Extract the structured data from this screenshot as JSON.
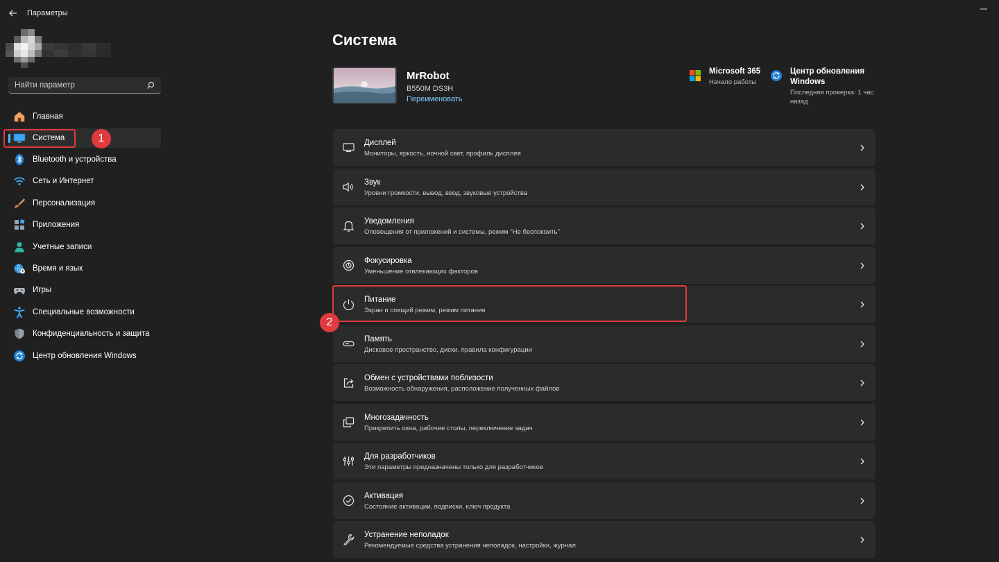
{
  "window": {
    "title": "Параметры"
  },
  "search": {
    "placeholder": "Найти параметр"
  },
  "sidebar": {
    "items": [
      {
        "label": "Главная",
        "icon": "home-icon"
      },
      {
        "label": "Система",
        "icon": "system-icon",
        "selected": true
      },
      {
        "label": "Bluetooth и устройства",
        "icon": "bluetooth-icon"
      },
      {
        "label": "Сеть и Интернет",
        "icon": "wifi-icon"
      },
      {
        "label": "Персонализация",
        "icon": "brush-icon"
      },
      {
        "label": "Приложения",
        "icon": "apps-icon"
      },
      {
        "label": "Учетные записи",
        "icon": "account-icon"
      },
      {
        "label": "Время и язык",
        "icon": "globe-clock-icon"
      },
      {
        "label": "Игры",
        "icon": "gamepad-icon"
      },
      {
        "label": "Специальные возможности",
        "icon": "accessibility-icon"
      },
      {
        "label": "Конфиденциальность и защита",
        "icon": "shield-icon"
      },
      {
        "label": "Центр обновления Windows",
        "icon": "update-icon"
      }
    ]
  },
  "main": {
    "title": "Система",
    "device": {
      "name": "MrRobot",
      "model": "B550M DS3H",
      "rename": "Переименовать"
    },
    "promos": [
      {
        "title": "Microsoft 365",
        "subtitle": "Начало работы",
        "icon": "microsoft-logo-icon"
      },
      {
        "title_line1": "Центр обновления",
        "title_line2": "Windows",
        "subtitle_line1": "Последняя проверка: 1 час",
        "subtitle_line2": "назад",
        "icon": "update-icon"
      }
    ],
    "cards": [
      {
        "title": "Дисплей",
        "subtitle": "Мониторы, яркость, ночной свет, профиль дисплея",
        "icon": "display-icon"
      },
      {
        "title": "Звук",
        "subtitle": "Уровни громкости, вывод, ввод, звуковые устройства",
        "icon": "speaker-icon"
      },
      {
        "title": "Уведомления",
        "subtitle": "Оповещения от приложений и системы, режим \"Не беспокоить\"",
        "icon": "bell-icon"
      },
      {
        "title": "Фокусировка",
        "subtitle": "Уменьшение отвлекающих факторов",
        "icon": "focus-icon"
      },
      {
        "title": "Питание",
        "subtitle": "Экран и спящий режим, режим питания",
        "icon": "power-icon"
      },
      {
        "title": "Память",
        "subtitle": "Дисковое пространство, диски, правила конфигурации",
        "icon": "storage-icon"
      },
      {
        "title": "Обмен с устройствами поблизости",
        "subtitle": "Возможность обнаружения, расположение полученных файлов",
        "icon": "share-icon"
      },
      {
        "title": "Многозадачность",
        "subtitle": "Прикрепить окна, рабочие столы, переключение задач",
        "icon": "multitask-icon"
      },
      {
        "title": "Для разработчиков",
        "subtitle": "Эти параметры предназначены только для разработчиков",
        "icon": "developer-tools-icon"
      },
      {
        "title": "Активация",
        "subtitle": "Состояние активации, подписки, ключ продукта",
        "icon": "check-circle-icon"
      },
      {
        "title": "Устранение неполадок",
        "subtitle": "Рекомендуемые средства устранения неполадок, настройки, журнал",
        "icon": "wrench-icon"
      }
    ]
  },
  "annotations": [
    {
      "label": "1"
    },
    {
      "label": "2"
    }
  ],
  "colors": {
    "accent": "#4cc2ff",
    "annotation": "#e0393e",
    "card": "#2b2b2b",
    "background": "#202020"
  }
}
